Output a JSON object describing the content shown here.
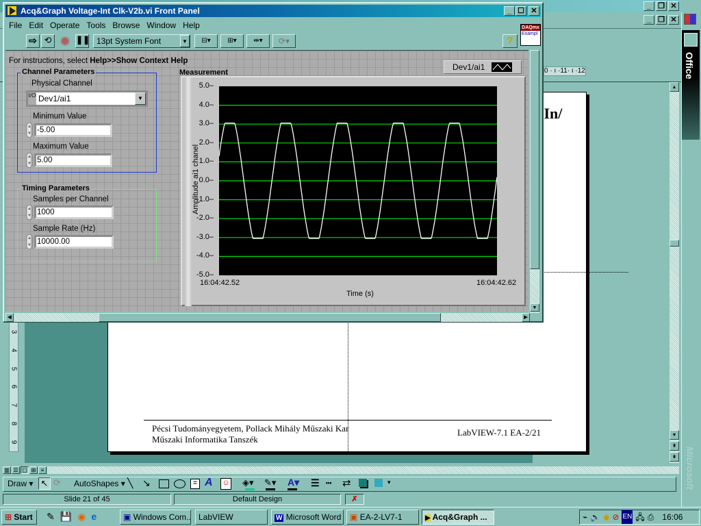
{
  "powerpoint": {
    "window_buttons": [
      "_",
      "❐",
      "✕"
    ],
    "ruler_h_text": "0 · ı ·11· ı ·12",
    "ruler_v_labels": [
      "3",
      "4",
      "5",
      "6",
      "7",
      "8",
      "9"
    ],
    "slide_partial_title": "g In/",
    "footer_left_line1": "Pécsi Tudományegyetem, Pollack Mihály Műszaki Kar",
    "footer_left_line2": "Műszaki Informatika Tanszék",
    "footer_right": "LabVIEW-7.1 EA-2/21",
    "office_bar_label": "Office",
    "office_watermark": "Microsoft",
    "draw_toolbar": {
      "draw_label": "Draw ▾",
      "autoshapes_label": "AutoShapes ▾"
    },
    "status": {
      "slide": "Slide 21 of 45",
      "design": "Default Design"
    }
  },
  "labview": {
    "title": "Acq&Graph Voltage-Int Clk-V2b.vi Front Panel",
    "menu": [
      "File",
      "Edit",
      "Operate",
      "Tools",
      "Browse",
      "Window",
      "Help"
    ],
    "font_select": "13pt System Font",
    "badge_top": "DAQmx",
    "badge_bottom": "Exampl",
    "help_glyph": "?",
    "instructions_prefix": "For instructions, select ",
    "instructions_bold": "Help>>Show Context Help",
    "channel_group": {
      "title": "Channel Parameters",
      "physical_channel_label": "Physical Channel",
      "physical_channel_value": "Dev1/ai1",
      "min_label": "Minimum Value",
      "min_value": "-5.00",
      "max_label": "Maximum Value",
      "max_value": "5.00"
    },
    "timing_group": {
      "title": "Timing Parameters",
      "samples_label": "Samples per Channel",
      "samples_value": "1000",
      "rate_label": "Sample Rate (Hz)",
      "rate_value": "10000.00"
    },
    "graph": {
      "label": "Measurement",
      "legend_name": "Dev1/ai1"
    }
  },
  "chart_data": {
    "type": "line",
    "title": "Measurement",
    "xlabel": "Time (s)",
    "ylabel": "Amplitude ai1 chanel",
    "x_tick_labels": [
      "16:04:42.52",
      "16:04:42.62"
    ],
    "y_ticks": [
      "5.0",
      "4.0",
      "3.0",
      "2.0",
      "1.0",
      "0.0",
      "-1.0",
      "-2.0",
      "-3.0",
      "-4.0",
      "-5.0"
    ],
    "ylim": [
      -5,
      5
    ],
    "xlim_seconds": [
      0,
      0.1
    ],
    "grid": "horizontal",
    "grid_color": "#00e000",
    "plot_bg": "#000000",
    "line_color": "#ffffff",
    "legend": [
      "Dev1/ai1"
    ],
    "legend_position": "top-right",
    "series": [
      {
        "name": "Dev1/ai1",
        "waveform": "clipped sine",
        "amplitude": 3.6,
        "clip_level": 3.05,
        "frequency_hz": 49.5,
        "start_value": 1.3,
        "cycles_visible": 5
      }
    ]
  },
  "taskbar": {
    "start": "Start",
    "tasks": [
      "Windows Com...",
      "LabVIEW",
      "Microsoft Word",
      "EA-2-LV7-1",
      "Acq&Graph ..."
    ],
    "tray_lang": "EN",
    "clock": "16:06"
  }
}
